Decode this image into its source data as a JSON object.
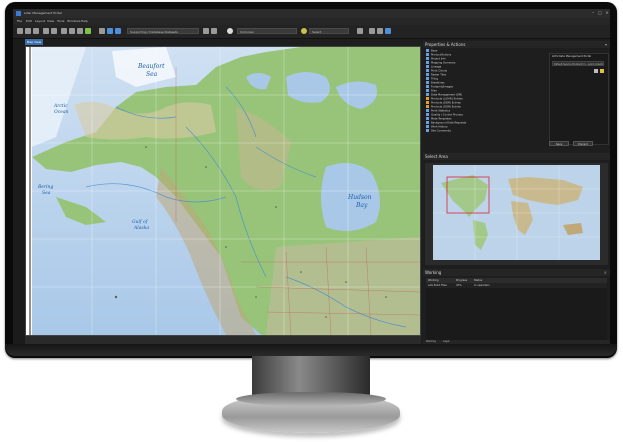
{
  "window": {
    "title": "Lidar Management Portal"
  },
  "menu": [
    "File",
    "Edit",
    "Layout",
    "View",
    "Tools",
    "Windows",
    "Help"
  ],
  "toolbar": {
    "layer_select": "Supporting / Database Datasets",
    "scale_select": "Unknown",
    "zoom_select": "Select"
  },
  "map_tab": {
    "label": "Map View"
  },
  "map": {
    "labels": {
      "beaufort": "Beaufort",
      "sea": "Sea",
      "arctic": "Arctic",
      "ocean": "Ocean",
      "hudson": "Hudson",
      "bay": "Bay",
      "bering": "Bering",
      "bering_sea": "Sea",
      "gulf": "Gulf of",
      "alaska": "Alaska"
    }
  },
  "properties_panel": {
    "title": "Properties & Actions",
    "items": [
      "Base",
      "Product/Actions",
      "Project Info",
      "Mapping Summary",
      "Lineage",
      "Point Clouds",
      "Raster Tiles",
      "Tiling",
      "Breaklines",
      "Footprint/Images",
      "Files",
      "Data Management (DM)",
      "Products (LiDAR) Entries",
      "Products (DEM) Entries",
      "Products (DSM) Entries",
      "Point Statistics",
      "Quality / Control Process",
      "Meta Templates",
      "Background Data Requests",
      "Work History",
      "Site Comments"
    ],
    "detail_label": "LIDS Data Management Portal",
    "detail_value": "Default Service Endpoint (1 - point collection)",
    "apply_button": "Save",
    "cancel_button": "Discard"
  },
  "select_area": {
    "title": "Select Area"
  },
  "working": {
    "title": "Working",
    "columns": [
      "Working",
      "Progress",
      "Status"
    ],
    "rows": [
      [
        "LAS Point Files",
        "47%",
        "In operation"
      ]
    ]
  },
  "bottom_tabs": [
    "Working",
    "Layer"
  ],
  "colors": {
    "accent": "#3c6ea8",
    "chrome": "#1e1e1e",
    "ocean": "#bcd3ea",
    "land": "#8fbf6a"
  }
}
